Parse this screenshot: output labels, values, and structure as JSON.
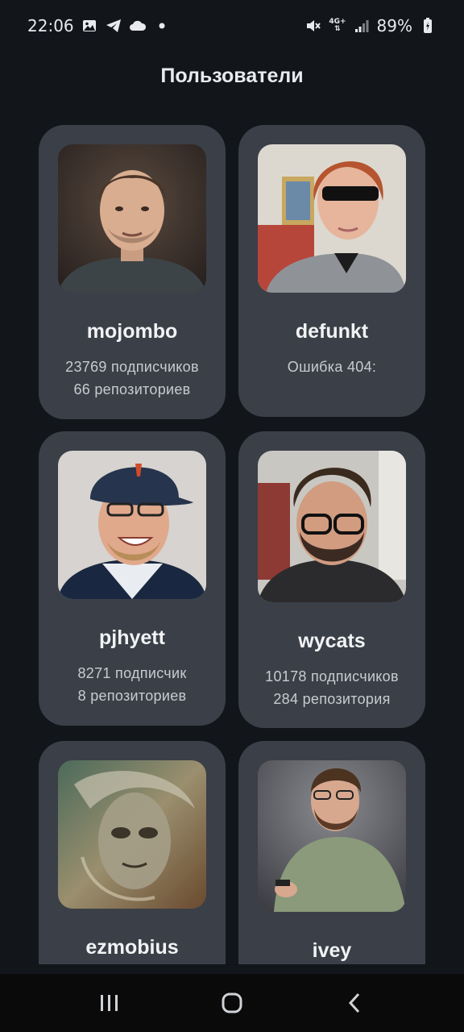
{
  "status_bar": {
    "time": "22:06",
    "network": "4G+",
    "battery": "89%",
    "left_icons": [
      "gallery-icon",
      "telegram-icon",
      "cloud-icon",
      "dot-icon"
    ],
    "right_icons": [
      "mute-icon",
      "network-type-icon",
      "signal-icon",
      "battery-icon"
    ]
  },
  "header": {
    "title": "Пользователи"
  },
  "users": [
    {
      "name": "mojombo",
      "line1": "23769 подписчиков",
      "line2": "66 репозиториев"
    },
    {
      "name": "defunkt",
      "line1": "Ошибка 404:",
      "line2": ""
    },
    {
      "name": "pjhyett",
      "line1": "8271 подписчик",
      "line2": "8 репозиториев"
    },
    {
      "name": "wycats",
      "line1": "10178 подписчиков",
      "line2": "284 репозитория"
    },
    {
      "name": "ezmobius",
      "line1": "",
      "line2": ""
    },
    {
      "name": "ivey",
      "line1": "",
      "line2": ""
    }
  ],
  "nav": {
    "recents": "recents-icon",
    "home": "home-icon",
    "back": "back-icon"
  },
  "colors": {
    "background": "#12161b",
    "card": "#3b3f47",
    "text_primary": "#f1f3f4",
    "text_secondary": "#c8cbd0"
  }
}
